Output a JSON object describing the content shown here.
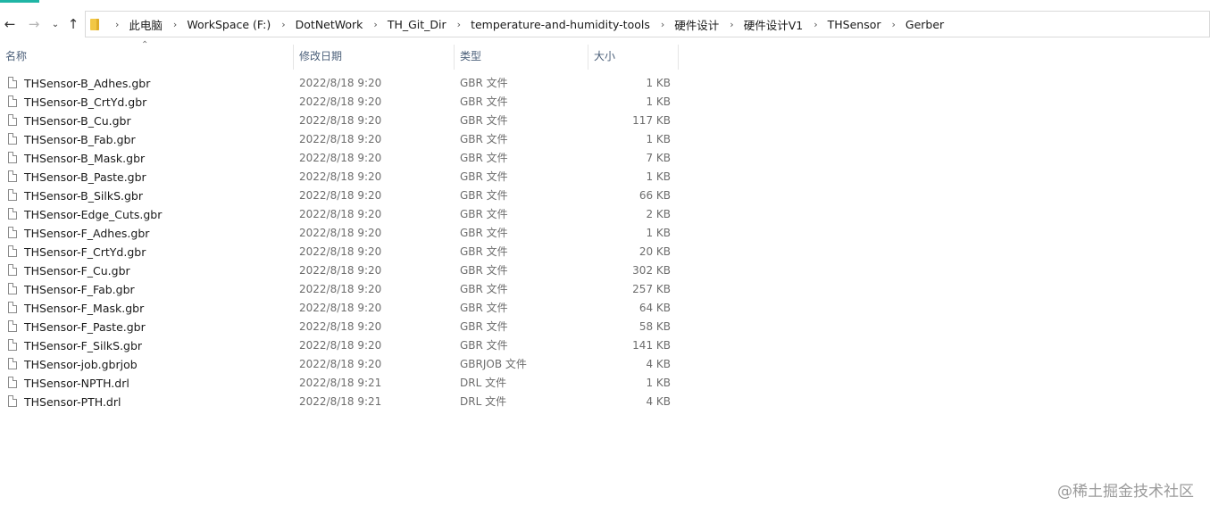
{
  "theme": {
    "accent": "#1fb5a5",
    "header_text": "#4c607a"
  },
  "nav": {
    "back_icon": "back-arrow-icon",
    "forward_icon": "forward-arrow-icon",
    "recent_icon": "chevron-down-icon",
    "up_icon": "up-arrow-icon"
  },
  "breadcrumb": [
    "此电脑",
    "WorkSpace (F:)",
    "DotNetWork",
    "TH_Git_Dir",
    "temperature-and-humidity-tools",
    "硬件设计",
    "硬件设计V1",
    "THSensor",
    "Gerber"
  ],
  "columns": {
    "name": "名称",
    "date": "修改日期",
    "type": "类型",
    "size": "大小"
  },
  "files": [
    {
      "name": "THSensor-B_Adhes.gbr",
      "date": "2022/8/18 9:20",
      "type": "GBR 文件",
      "size": "1 KB"
    },
    {
      "name": "THSensor-B_CrtYd.gbr",
      "date": "2022/8/18 9:20",
      "type": "GBR 文件",
      "size": "1 KB"
    },
    {
      "name": "THSensor-B_Cu.gbr",
      "date": "2022/8/18 9:20",
      "type": "GBR 文件",
      "size": "117 KB"
    },
    {
      "name": "THSensor-B_Fab.gbr",
      "date": "2022/8/18 9:20",
      "type": "GBR 文件",
      "size": "1 KB"
    },
    {
      "name": "THSensor-B_Mask.gbr",
      "date": "2022/8/18 9:20",
      "type": "GBR 文件",
      "size": "7 KB"
    },
    {
      "name": "THSensor-B_Paste.gbr",
      "date": "2022/8/18 9:20",
      "type": "GBR 文件",
      "size": "1 KB"
    },
    {
      "name": "THSensor-B_SilkS.gbr",
      "date": "2022/8/18 9:20",
      "type": "GBR 文件",
      "size": "66 KB"
    },
    {
      "name": "THSensor-Edge_Cuts.gbr",
      "date": "2022/8/18 9:20",
      "type": "GBR 文件",
      "size": "2 KB"
    },
    {
      "name": "THSensor-F_Adhes.gbr",
      "date": "2022/8/18 9:20",
      "type": "GBR 文件",
      "size": "1 KB"
    },
    {
      "name": "THSensor-F_CrtYd.gbr",
      "date": "2022/8/18 9:20",
      "type": "GBR 文件",
      "size": "20 KB"
    },
    {
      "name": "THSensor-F_Cu.gbr",
      "date": "2022/8/18 9:20",
      "type": "GBR 文件",
      "size": "302 KB"
    },
    {
      "name": "THSensor-F_Fab.gbr",
      "date": "2022/8/18 9:20",
      "type": "GBR 文件",
      "size": "257 KB"
    },
    {
      "name": "THSensor-F_Mask.gbr",
      "date": "2022/8/18 9:20",
      "type": "GBR 文件",
      "size": "64 KB"
    },
    {
      "name": "THSensor-F_Paste.gbr",
      "date": "2022/8/18 9:20",
      "type": "GBR 文件",
      "size": "58 KB"
    },
    {
      "name": "THSensor-F_SilkS.gbr",
      "date": "2022/8/18 9:20",
      "type": "GBR 文件",
      "size": "141 KB"
    },
    {
      "name": "THSensor-job.gbrjob",
      "date": "2022/8/18 9:20",
      "type": "GBRJOB 文件",
      "size": "4 KB"
    },
    {
      "name": "THSensor-NPTH.drl",
      "date": "2022/8/18 9:21",
      "type": "DRL 文件",
      "size": "1 KB"
    },
    {
      "name": "THSensor-PTH.drl",
      "date": "2022/8/18 9:21",
      "type": "DRL 文件",
      "size": "4 KB"
    }
  ],
  "watermark": "@稀土掘金技术社区"
}
